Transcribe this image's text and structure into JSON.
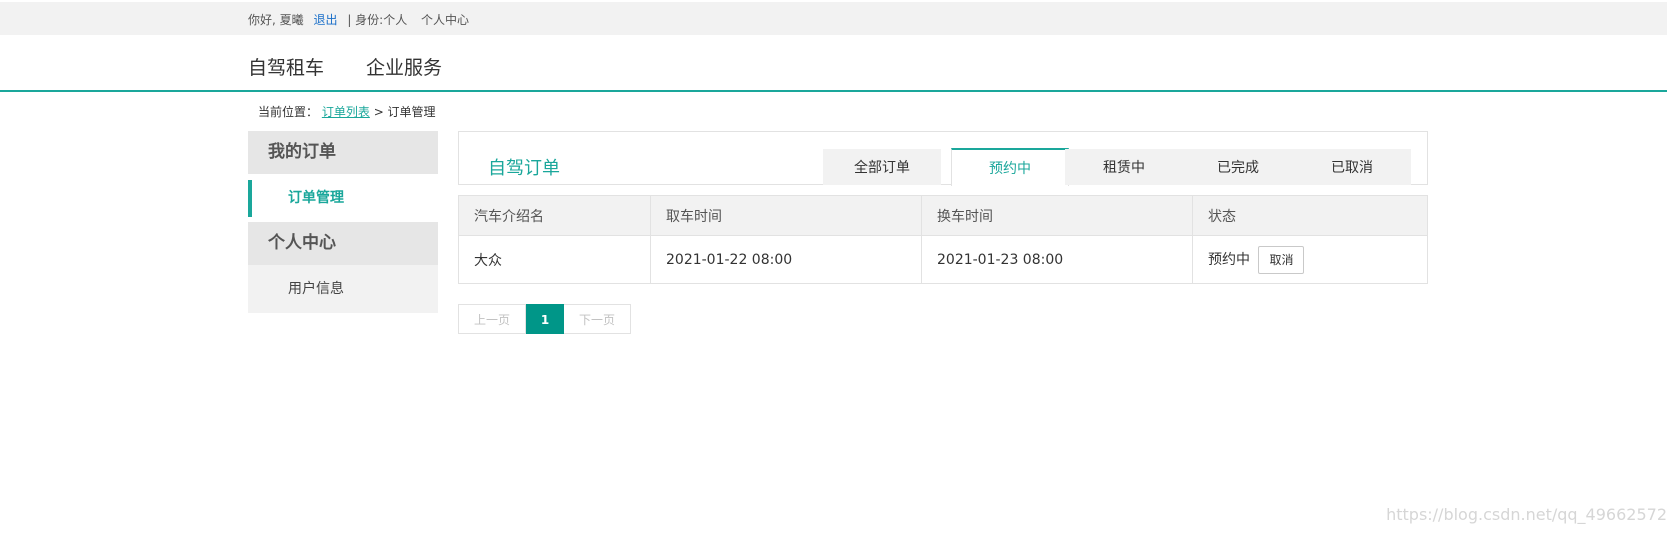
{
  "topbar": {
    "greeting": "你好, 夏曦",
    "logout": "退出",
    "role": "| 身份:个人",
    "center": "个人中心"
  },
  "nav": {
    "items": [
      "自驾租车",
      "企业服务"
    ]
  },
  "breadcrumb": {
    "prefix": "当前位置：",
    "link": "订单列表",
    "current": "> 订单管理"
  },
  "sidebar": {
    "groups": [
      {
        "title": "我的订单",
        "items": [
          "订单管理"
        ]
      },
      {
        "title": "个人中心",
        "items": [
          "用户信息"
        ]
      }
    ]
  },
  "orders": {
    "title": "自驾订单",
    "tabs": [
      "全部订单",
      "预约中",
      "租赁中",
      "已完成",
      "已取消"
    ],
    "active_tab": "预约中",
    "columns": [
      "汽车介绍名",
      "取车时间",
      "换车时间",
      "状态"
    ],
    "rows": [
      {
        "name": "大众",
        "pickup": "2021-01-22 08:00",
        "return": "2021-01-23 08:00",
        "status": "预约中",
        "action": "取消"
      }
    ]
  },
  "pager": {
    "prev": "上一页",
    "current": "1",
    "next": "下一页"
  },
  "watermark": "https://blog.csdn.net/qq_49662572",
  "colors": {
    "accent": "#1aa79b",
    "pager_active": "#009688",
    "link": "#1a6fc9"
  }
}
